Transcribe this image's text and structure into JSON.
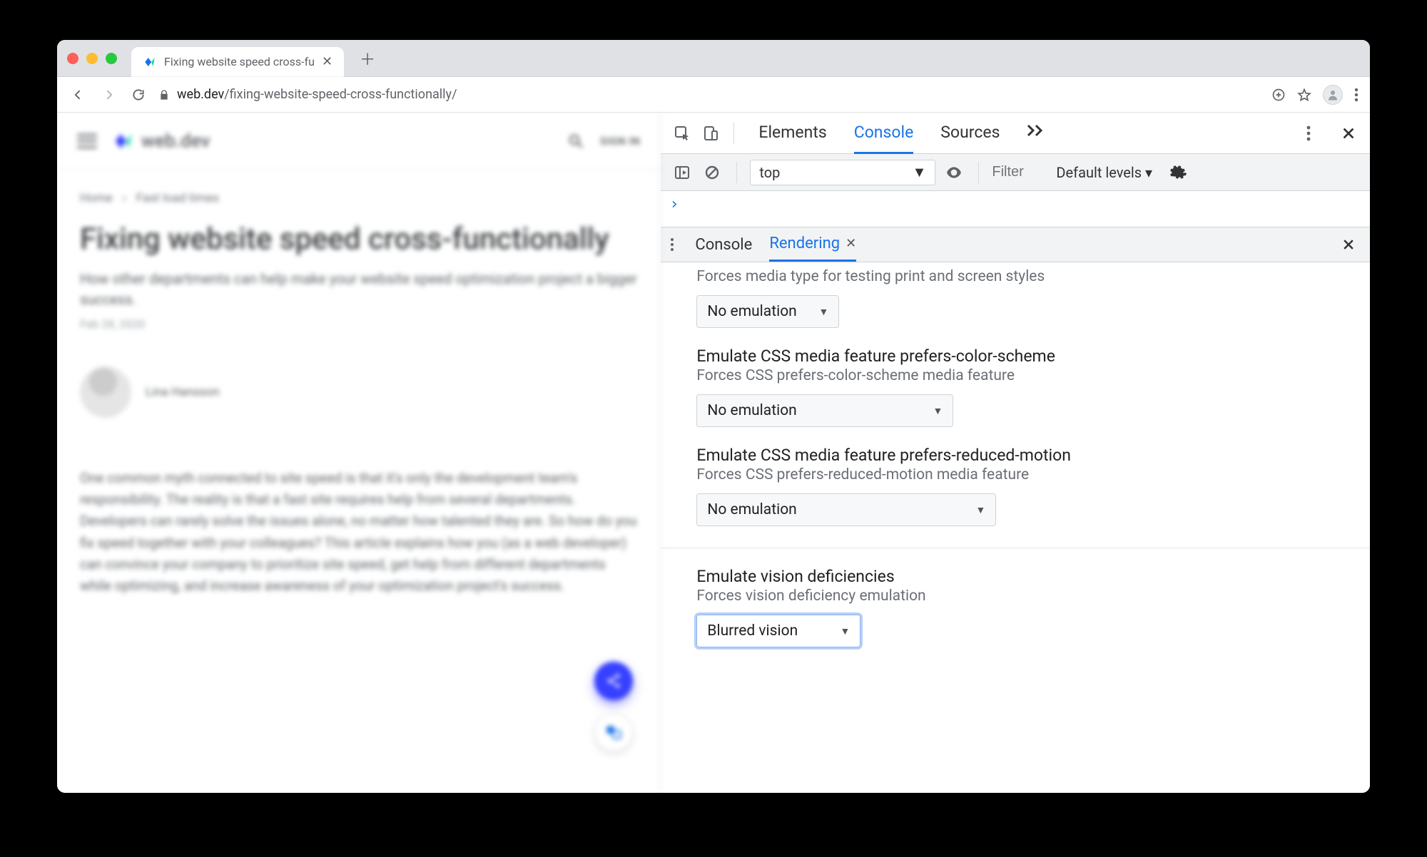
{
  "browser": {
    "tab_title": "Fixing website speed cross-fu",
    "url_domain": "web.dev",
    "url_path": "/fixing-website-speed-cross-functionally/"
  },
  "page": {
    "brand": "web.dev",
    "sign_in": "SIGN IN",
    "crumbs": {
      "home": "Home",
      "section": "Fast load times"
    },
    "headline": "Fixing website speed cross-functionally",
    "subtitle": "How other departments can help make your website speed optimization project a bigger success.",
    "date": "Feb 28, 2020",
    "author": "Lina Hansson",
    "body": "One common myth connected to site speed is that it's only the development team's responsibility. The reality is that a fast site requires help from several departments. Developers can rarely solve the issues alone, no matter how talented they are. So how do you fix speed together with your colleagues? This article explains how you (as a web developer) can convince your company to prioritize site speed, get help from different departments while optimizing, and increase awareness of your optimization project's success."
  },
  "devtools": {
    "tabs": {
      "elements": "Elements",
      "console": "Console",
      "sources": "Sources"
    },
    "context": "top",
    "filter_placeholder": "Filter",
    "levels": "Default levels ▾",
    "drawer": {
      "console": "Console",
      "rendering": "Rendering"
    },
    "sections": {
      "mediaType": {
        "desc": "Forces media type for testing print and screen styles",
        "value": "No emulation"
      },
      "colorScheme": {
        "title": "Emulate CSS media feature prefers-color-scheme",
        "desc": "Forces CSS prefers-color-scheme media feature",
        "value": "No emulation"
      },
      "reducedMotion": {
        "title": "Emulate CSS media feature prefers-reduced-motion",
        "desc": "Forces CSS prefers-reduced-motion media feature",
        "value": "No emulation"
      },
      "vision": {
        "title": "Emulate vision deficiencies",
        "desc": "Forces vision deficiency emulation",
        "value": "Blurred vision"
      }
    }
  }
}
